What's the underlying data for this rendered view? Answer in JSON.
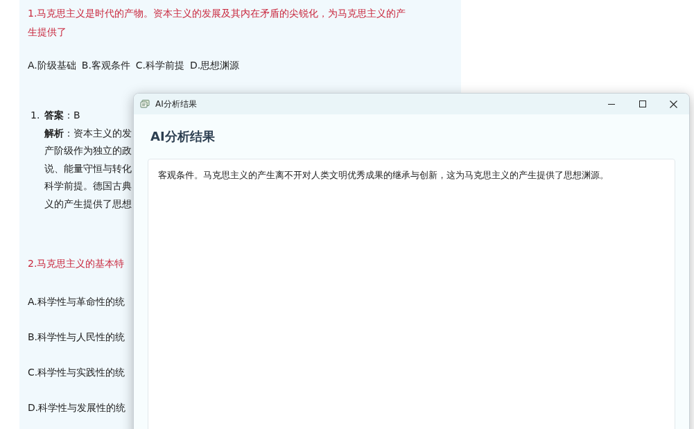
{
  "page": {
    "questions": [
      {
        "kind": "question_inline",
        "stem_lines": [
          "1.马克思主义是时代的产物。资本主义的发展及其内在矛盾的尖锐化，为马克思主义的产",
          "生提供了"
        ],
        "options": [
          "A.阶级基础",
          "B.客观条件",
          "C.科学前提",
          "D.思想渊源"
        ]
      },
      {
        "kind": "answer",
        "number": "1.",
        "lines": [
          "**答案**：B",
          "**解析**：资本主义的发",
          "产阶级作为独立的政",
          "说、能量守恒与转化",
          "科学前提。德国古典",
          "义的产生提供了思想"
        ]
      },
      {
        "kind": "question_stacked",
        "stem_lines": [
          "2.马克思主义的基本特"
        ],
        "options": [
          "A.科学性与革命性的统",
          "B.科学性与人民性的统",
          "C.科学性与实践性的统",
          "D.科学性与发展性的统"
        ]
      }
    ]
  },
  "dialog": {
    "title": "AI分析结果",
    "heading": "AI分析结果",
    "result": "客观条件。马克思主义的产生离不开对人类文明优秀成果的继承与创新，这为马克思主义的产生提供了思想渊源。"
  }
}
